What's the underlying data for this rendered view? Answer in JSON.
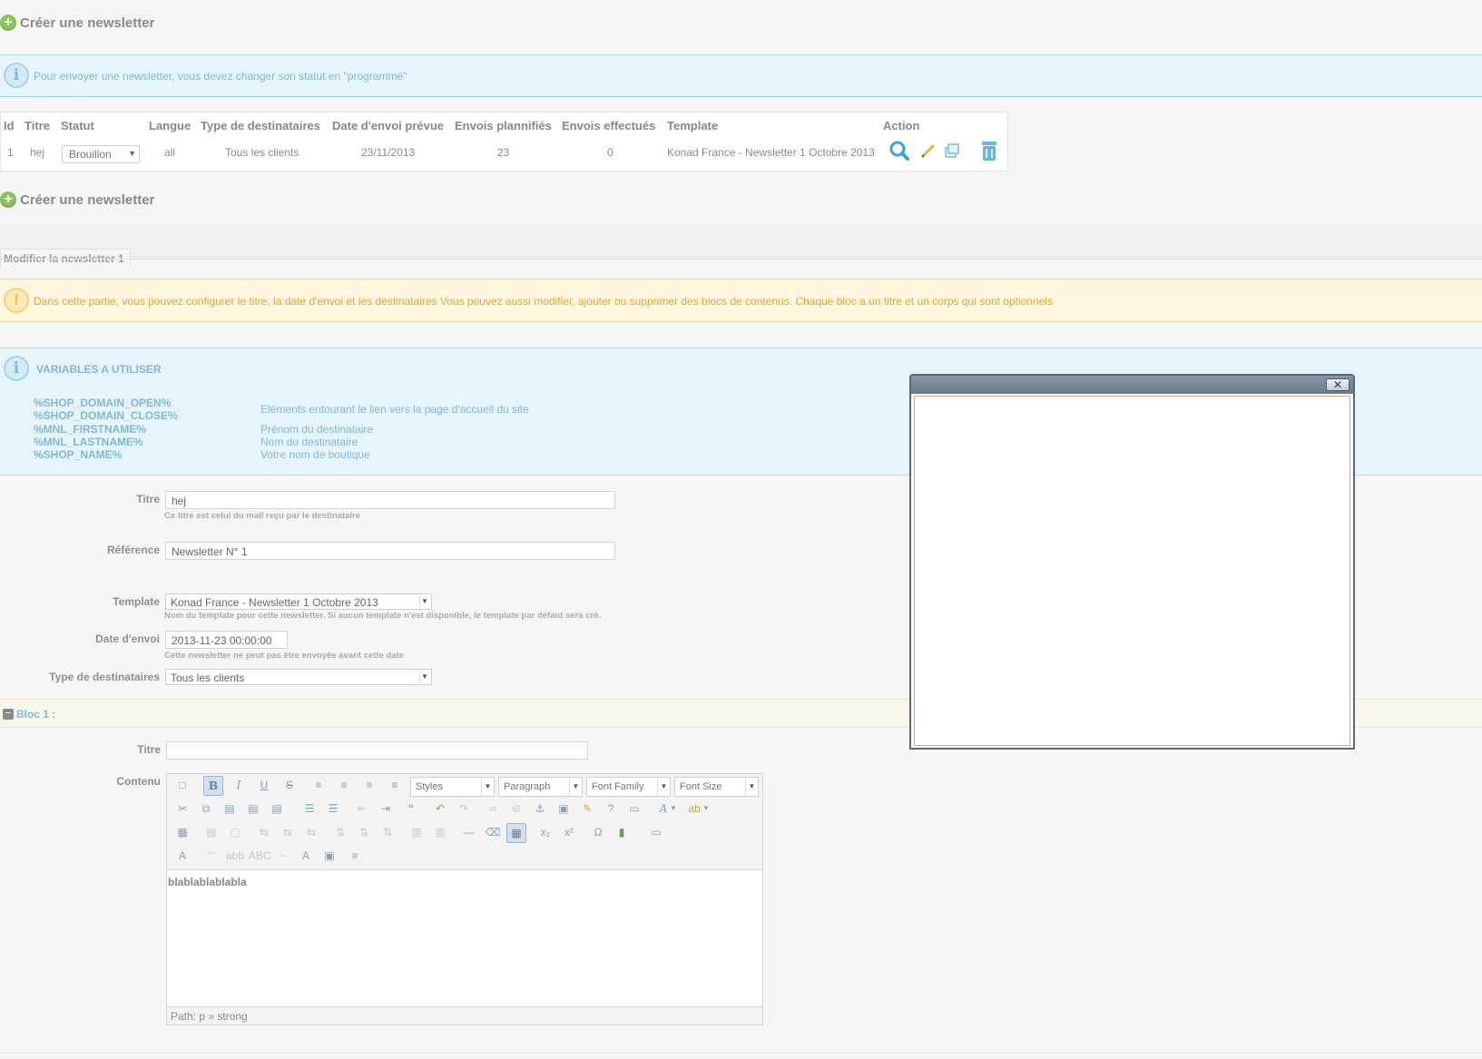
{
  "create_label": "Créer une newsletter",
  "info_message": "Pour envoyer une newsletter, vous devez changer son statut en \"programmé\"",
  "table": {
    "headers": {
      "id": "Id",
      "titre": "Titre",
      "statut": "Statut",
      "langue": "Langue",
      "type": "Type de destinataires",
      "date": "Date d'envoi prévue",
      "planifies": "Envois plannifiés",
      "effectues": "Envois effectués",
      "template": "Template",
      "action": "Action"
    },
    "row": {
      "id": "1",
      "titre": "hej",
      "statut": "Brouillon",
      "langue": "all",
      "type": "Tous les clients",
      "date": "23/11/2013",
      "planifies": "23",
      "effectues": "0",
      "template": "Konad France - Newsletter 1 Octobre 2013"
    },
    "action_icons": [
      "search-icon",
      "edit-icon",
      "duplicate-icon",
      "delete-icon"
    ]
  },
  "tab_label": "Modifier la newsletter 1",
  "warning_message": "Dans cette partie, vous pouvez configurer le titre, la date d'envoi et les destinataires Vous pouvez aussi modifier, ajouter ou supprimer des blocs de contenus. Chaque bloc a un titre et un corps qui sont optionnels",
  "variables": {
    "title": "VARIABLES A UTILISER",
    "codes": [
      "%SHOP_DOMAIN_OPEN%",
      "%SHOP_DOMAIN_CLOSE%",
      "%MNL_FIRSTNAME%",
      "%MNL_LASTNAME%",
      "%SHOP_NAME%"
    ],
    "descriptions": [
      "Eléments entourant le lien vers la page d'accueil du site",
      "Prénom du destinataire",
      "Nom du destinataire",
      "Votre nom de boutique"
    ]
  },
  "form": {
    "titre_label": "Titre",
    "titre_value": "hej",
    "titre_hint": "Ce titre est celui du mail reçu par le destinataire",
    "reference_label": "Référence",
    "reference_value": "Newsletter N° 1",
    "template_label": "Template",
    "template_value": "Konad France - Newsletter 1 Octobre 2013",
    "template_hint": "Nom du template pour cette newsletter. Si aucun template n'est disponible, le template par défaut sera cré.",
    "date_label": "Date d'envoi",
    "date_value": "2013-11-23 00:00:00",
    "date_hint": "Cette newsletter ne peut pas être envoyée avant cette date",
    "type_label": "Type de destinataires",
    "type_value": "Tous les clients"
  },
  "bloc": {
    "label": "Bloc 1 :",
    "titre_label": "Titre",
    "titre_value": "",
    "contenu_label": "Contenu",
    "toolbar": {
      "styles": "Styles",
      "paragraph": "Paragraph",
      "font_family": "Font Family",
      "font_size": "Font Size"
    },
    "content": "blablablablabla",
    "path": "Path: p » strong"
  },
  "popup": {
    "close_label": "✕"
  },
  "colors": {
    "info_bg": "#e6f4fb",
    "warn_bg": "#fff6e0",
    "accent_green": "#8dc35b",
    "link_blue": "#84b7d6"
  }
}
